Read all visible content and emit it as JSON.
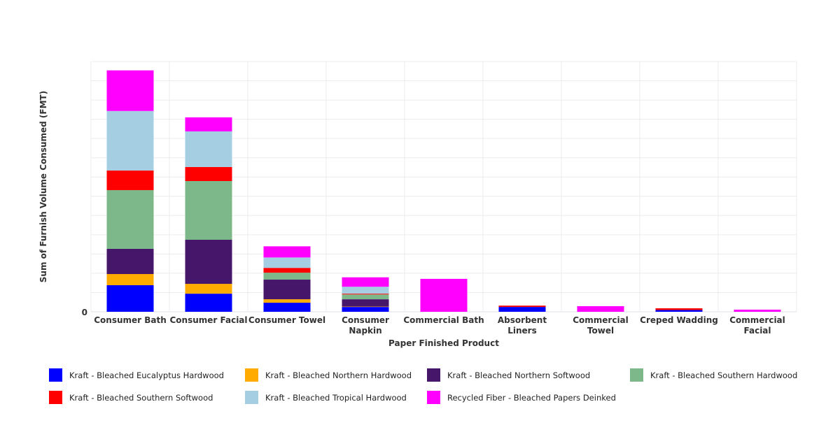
{
  "chart_data": {
    "type": "bar",
    "stacked": true,
    "title": "",
    "xlabel": "Paper Finished Product",
    "ylabel": "Sum of Furnish Volume Consumed (FMT)",
    "y_tick_labels": [
      "0"
    ],
    "y_units_note": "relative units (axis shows only 0; 1 unit = 1 gridline step)",
    "ylim": [
      0,
      13
    ],
    "grid": true,
    "legend_position": "bottom",
    "categories": [
      "Consumer Bath",
      "Consumer Facial",
      "Consumer Towel",
      "Consumer Napkin",
      "Commercial Bath",
      "Absorbent Liners",
      "Commercial Towel",
      "Creped Wadding",
      "Commercial Facial"
    ],
    "category_labels": [
      [
        "Consumer Bath"
      ],
      [
        "Consumer Facial"
      ],
      [
        "Consumer Towel"
      ],
      [
        "Consumer",
        "Napkin"
      ],
      [
        "Commercial Bath"
      ],
      [
        "Absorbent",
        "Liners"
      ],
      [
        "Commercial",
        "Towel"
      ],
      [
        "Creped Wadding"
      ],
      [
        "Commercial",
        "Facial"
      ]
    ],
    "series": [
      {
        "name": "Kraft - Bleached Eucalyptus Hardwood",
        "color": "#0000ff",
        "values": [
          1.38,
          0.94,
          0.47,
          0.25,
          0,
          0.25,
          0,
          0.09,
          0
        ]
      },
      {
        "name": "Kraft - Bleached Northern Hardwood",
        "color": "#ffab00",
        "values": [
          0.58,
          0.51,
          0.18,
          0.02,
          0,
          0,
          0,
          0,
          0
        ]
      },
      {
        "name": "Kraft - Bleached Northern Softwood",
        "color": "#46166b",
        "values": [
          1.31,
          2.29,
          1.02,
          0.38,
          0,
          0,
          0,
          0,
          0
        ]
      },
      {
        "name": "Kraft - Bleached Southern Hardwood",
        "color": "#7db88a",
        "values": [
          3.05,
          3.05,
          0.36,
          0.25,
          0,
          0,
          0,
          0,
          0
        ]
      },
      {
        "name": "Kraft - Bleached Southern Softwood",
        "color": "#ff0000",
        "values": [
          1.02,
          0.73,
          0.25,
          0.04,
          0,
          0.07,
          0,
          0.09,
          0
        ]
      },
      {
        "name": "Kraft - Bleached Tropical Hardwood",
        "color": "#a6cee3",
        "values": [
          3.09,
          1.85,
          0.54,
          0.36,
          0,
          0,
          0,
          0,
          0
        ]
      },
      {
        "name": "Recycled Fiber - Bleached Papers Deinked",
        "color": "#ff00ff",
        "values": [
          2.11,
          0.73,
          0.58,
          0.49,
          1.71,
          0,
          0.29,
          0,
          0.11
        ]
      }
    ]
  }
}
